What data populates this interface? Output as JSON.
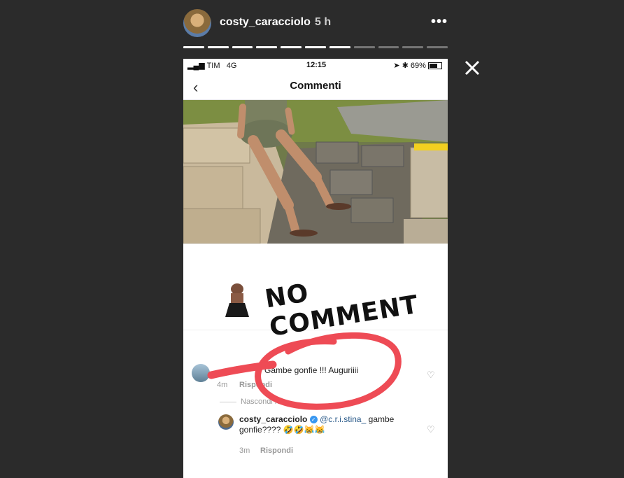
{
  "story": {
    "username": "costy_caracciolo",
    "time": "5 h",
    "segments_total": 11,
    "segments_done": 7
  },
  "phone": {
    "status": {
      "carrier": "TIM",
      "network": "4G",
      "time": "12:15",
      "battery": "69%"
    },
    "nav": {
      "title": "Commenti"
    },
    "caption_overlay": "NO COMMENT",
    "comments": [
      {
        "text": "Gambe gonfie !!! Auguriiii",
        "time": "4m",
        "reply_label": "Rispondi"
      }
    ],
    "hide_replies": "Nascondi ri",
    "reply": {
      "username": "costy_caracciolo",
      "mention": "@c.r.i.stina_",
      "text_line1": "gambe",
      "text_line2": "gonfie???? 🤣🤣😹😹",
      "time": "3m",
      "reply_label": "Rispondi"
    }
  }
}
